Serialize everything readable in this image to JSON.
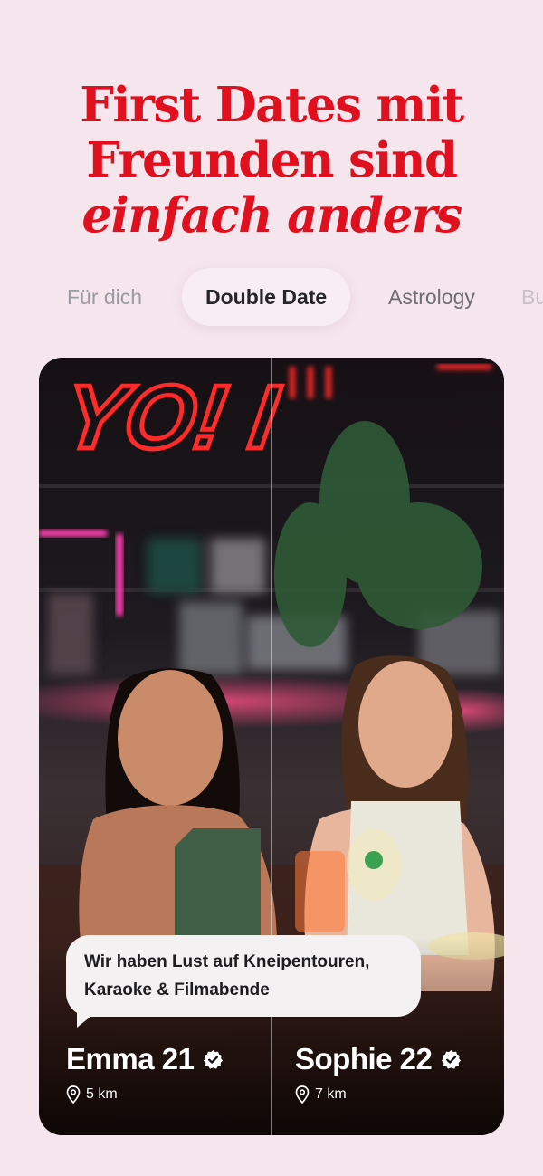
{
  "headline": {
    "line1": "First Dates mit",
    "line2": "Freunden sind",
    "line3": "einfach anders"
  },
  "tabs": [
    {
      "label": "Für dich",
      "active": false
    },
    {
      "label": "Double Date",
      "active": true
    },
    {
      "label": "Astrology",
      "active": false
    },
    {
      "label": "Bu",
      "active": false
    }
  ],
  "card": {
    "neon_sign": "YO! I",
    "bubble_text": "Wir haben Lust auf Kneipentouren, Karaoke & Filmabende",
    "people": [
      {
        "name": "Emma 21",
        "distance": "5 km",
        "verified": true
      },
      {
        "name": "Sophie 22",
        "distance": "7 km",
        "verified": true
      }
    ]
  },
  "colors": {
    "background": "#f5e6ee",
    "headline": "#e0101e",
    "neon": "#ff2a2a",
    "bubble": "#f3f1f2"
  }
}
